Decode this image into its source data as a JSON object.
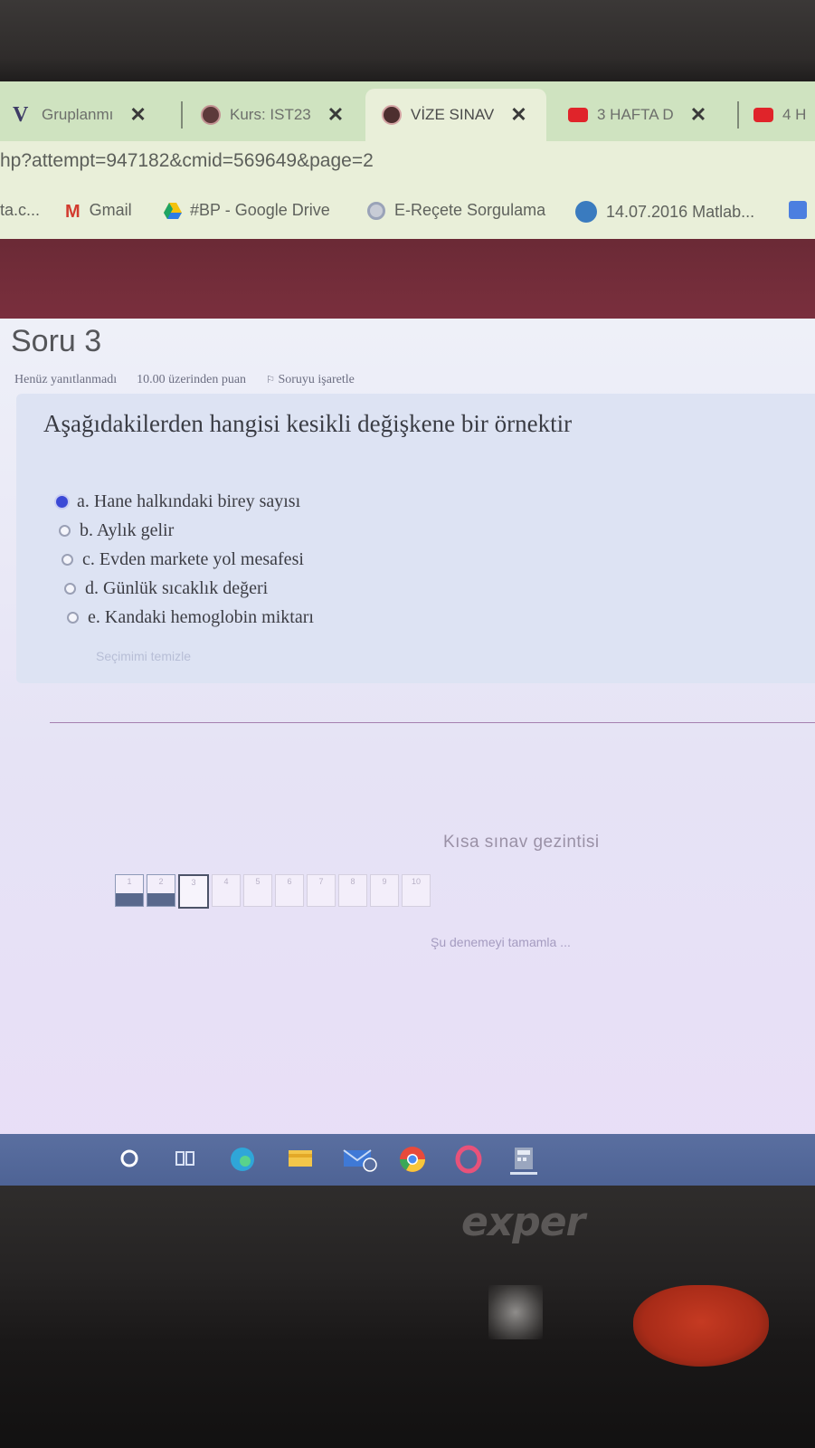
{
  "browser": {
    "tabs": [
      {
        "label": "Gruplanmı",
        "close": "✕",
        "icon": "v-icon"
      },
      {
        "label": "Kurs: IST23",
        "close": "✕",
        "icon": "moodle-icon"
      },
      {
        "label": "VİZE SINAV",
        "close": "✕",
        "icon": "moodle-icon",
        "active": true
      },
      {
        "label": "3 HAFTA D",
        "close": "✕",
        "icon": "youtube-icon"
      },
      {
        "label": "4 H",
        "icon": "youtube-icon"
      }
    ],
    "url": "hp?attempt=947182&cmid=569649&page=2",
    "bookmarks": [
      {
        "label": "ta.c...",
        "icon": ""
      },
      {
        "label": "Gmail",
        "icon": "gmail-icon"
      },
      {
        "label": "#BP - Google Drive",
        "icon": "drive-icon"
      },
      {
        "label": "E-Reçete Sorgulama",
        "icon": "globe-icon"
      },
      {
        "label": "14.07.2016 Matlab...",
        "icon": "wordpress-icon"
      }
    ]
  },
  "question": {
    "title": "Soru 3",
    "status": "Henüz yanıtlanmadı",
    "points": "10.00 üzerinden puan",
    "flag": "Soruyu işaretle",
    "text": "Aşağıdakilerden hangisi kesikli değişkene bir örnektir",
    "options": [
      {
        "label": "a. Hane halkındaki birey sayısı",
        "selected": true
      },
      {
        "label": "b. Aylık gelir",
        "selected": false
      },
      {
        "label": "c. Evden markete yol mesafesi",
        "selected": false
      },
      {
        "label": "d. Günlük sıcaklık değeri",
        "selected": false
      },
      {
        "label": "e. Kandaki hemoglobin miktarı",
        "selected": false
      }
    ],
    "clear_choice": "Seçimimi temizle"
  },
  "navigation": {
    "title": "Kısa sınav gezintisi",
    "buttons": [
      {
        "num": "1",
        "state": "answered"
      },
      {
        "num": "2",
        "state": "answered"
      },
      {
        "num": "3",
        "state": "current"
      },
      {
        "num": "4",
        "state": "empty"
      },
      {
        "num": "5",
        "state": "empty"
      },
      {
        "num": "6",
        "state": "empty"
      },
      {
        "num": "7",
        "state": "empty"
      },
      {
        "num": "8",
        "state": "empty"
      },
      {
        "num": "9",
        "state": "empty"
      },
      {
        "num": "10",
        "state": "empty"
      }
    ],
    "finish": "Şu denemeyi tamamla ..."
  },
  "monitor": {
    "brand": "exper"
  },
  "colors": {
    "header": "#7a2f3d",
    "accent": "#3b49d6",
    "taskbar": "#5a6fa0"
  }
}
